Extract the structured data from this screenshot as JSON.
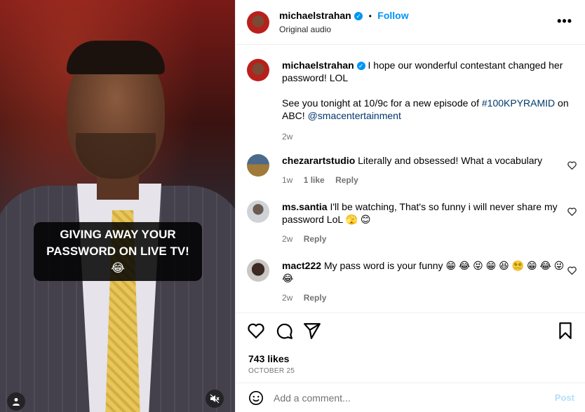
{
  "media": {
    "caption_line1": "GIVING AWAY YOUR",
    "caption_line2": "PASSWORD ON LIVE TV! 😂",
    "user_icon": "user-icon",
    "mute_icon": "muted-speaker-icon"
  },
  "header": {
    "username": "michaelstrahan",
    "separator": "•",
    "follow_label": "Follow",
    "audio": "Original audio",
    "more": "•••"
  },
  "post": {
    "username": "michaelstrahan",
    "text_1": "I hope our wonderful contestant changed her password! LOL",
    "text_2a": "See you tonight at 10/9c for a new episode of",
    "hashtag": "#100KPYRAMID",
    "text_2b": "on ABC!",
    "mention": "@smacentertainment",
    "time": "2w"
  },
  "comments": [
    {
      "username": "chezarartstudio",
      "text": "Literally and obsessed! What a vocabulary",
      "time": "1w",
      "likes": "1 like",
      "reply": "Reply"
    },
    {
      "username": "ms.santia",
      "text": "I'll be watching, That's so funny i will never share my password LoL 🫣 😊",
      "time": "2w",
      "reply": "Reply"
    },
    {
      "username": "mact222",
      "text": "My pass word is your funny 😁 😂 😝 😁 😆 😵‍💫 😁 😂 😜 😂",
      "time": "2w",
      "reply": "Reply"
    }
  ],
  "actions": {
    "likes": "743 likes",
    "date": "OCTOBER 25",
    "comment_placeholder": "Add a comment...",
    "post_label": "Post"
  },
  "colors": {
    "accent": "#0095f6",
    "verified": "#0095f6",
    "muted": "#737373"
  }
}
